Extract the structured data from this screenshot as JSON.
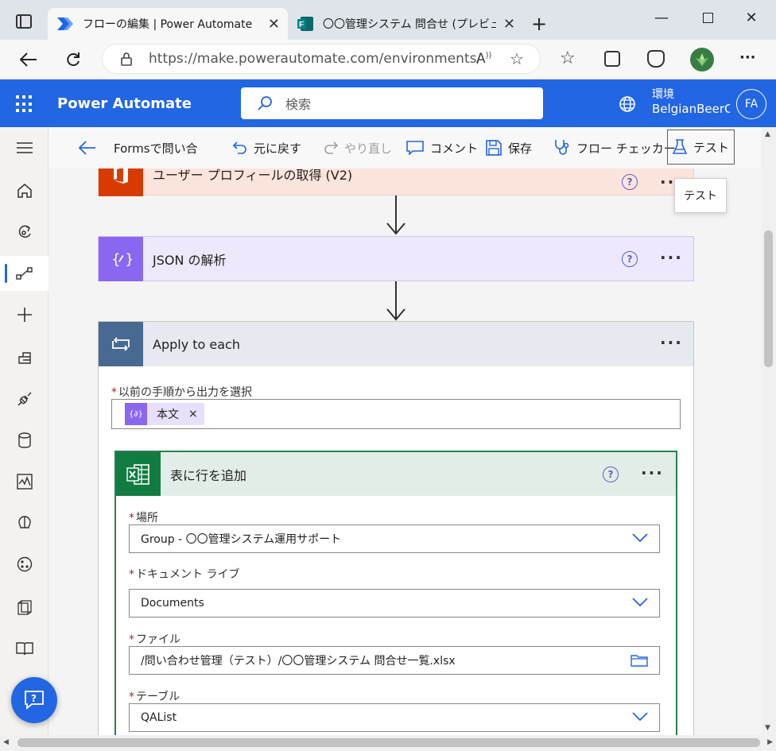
{
  "browser": {
    "tabs": [
      {
        "label": "フローの編集 | Power Automate",
        "active": true
      },
      {
        "label": "〇〇管理システム 問合せ (プレビュー)",
        "active": false
      }
    ],
    "url": "https://make.powerautomate.com/environments/..."
  },
  "app": {
    "name": "Power Automate",
    "search_placeholder": "検索",
    "env_label": "環境",
    "env_name": "BelgianBeerC",
    "avatar": "FA",
    "brand_color": "#2266e3"
  },
  "commandbar": {
    "flow_name": "Formsで問い合",
    "undo": "元に戻す",
    "redo": "やり直し",
    "comment": "コメント",
    "save": "保存",
    "checker": "フロー チェッカー",
    "test": "テスト",
    "tooltip": "テスト"
  },
  "flow": {
    "step1": {
      "title": "ユーザー プロフィールの取得 (V2)",
      "color": "#d83b01"
    },
    "step2": {
      "title": "JSON の解析",
      "color": "#8a67f0"
    },
    "step3": {
      "title": "Apply to each",
      "color": "#486991",
      "select_label": "以前の手順から出力を選択",
      "token": "本文"
    },
    "step4": {
      "title": "表に行を追加",
      "color": "#107c41",
      "fields": {
        "location_label": "場所",
        "location_value": "Group - 〇〇管理システム運用サポート",
        "library_label": "ドキュメント ライブラリ",
        "library_value": "Documents",
        "file_label": "ファイル",
        "file_value": "/問い合わせ管理（テスト）/〇〇管理システム 問合せ一覧.xlsx",
        "table_label": "テーブル",
        "table_value": "QAList"
      }
    }
  }
}
